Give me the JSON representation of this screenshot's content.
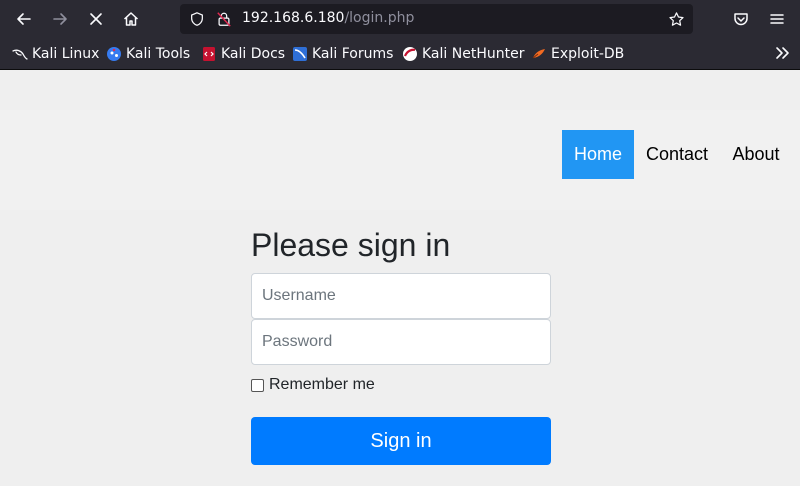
{
  "browser": {
    "url_host": "192.168.6.180",
    "url_path": "/login.php",
    "bookmarks": [
      {
        "label": "Kali Linux"
      },
      {
        "label": "Kali Tools"
      },
      {
        "label": "Kali Docs"
      },
      {
        "label": "Kali Forums"
      },
      {
        "label": "Kali NetHunter"
      },
      {
        "label": "Exploit-DB"
      }
    ]
  },
  "nav": {
    "home": "Home",
    "contact": "Contact",
    "about": "About"
  },
  "login": {
    "title": "Please sign in",
    "username_placeholder": "Username",
    "password_placeholder": "Password",
    "remember_label": "Remember me",
    "submit_label": "Sign in"
  },
  "colors": {
    "active_nav": "#2196f3",
    "primary_button": "#007bff"
  }
}
